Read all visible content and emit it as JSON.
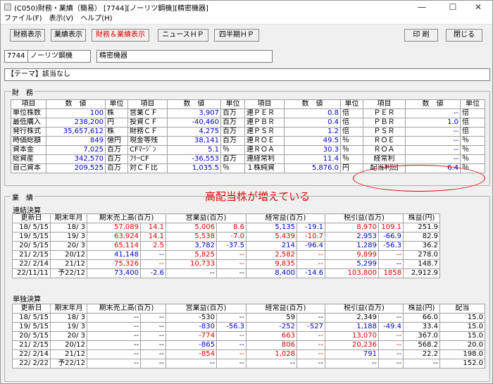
{
  "window": {
    "title": "(C050)財務・業績（簡易） [7744][ノーリツ鋼機][精密機器]",
    "minimize": "—",
    "maximize": "☐",
    "close": "✕"
  },
  "menu": [
    "ファイル(F)",
    "表示(V)",
    "ヘルプ(H)"
  ],
  "toolbar": {
    "fin": "財務表示",
    "perf": "業績表示",
    "both": "財務＆業績表示",
    "news": "ニュースＨＰ",
    "quarter": "四半期ＨＰ",
    "print": "印 刷",
    "closeBtn": "閉じる"
  },
  "company": {
    "code": "7744",
    "name": "ノーリツ鋼機",
    "sector": "精密機器"
  },
  "theme": "【テーマ】該当なし",
  "finance": {
    "label": "財　務",
    "headers": [
      "項目",
      "数　値",
      "単位",
      "項目",
      "数　値",
      "単位",
      "項目",
      "数　値",
      "単位",
      "項目",
      "数　値",
      "単位"
    ],
    "rows": [
      [
        [
          "単位株数",
          ""
        ],
        [
          "100",
          "blue"
        ],
        "株",
        [
          "営業ＣＦ",
          ""
        ],
        [
          "3,907",
          "blue"
        ],
        "百万",
        [
          "連ＰＥＲ",
          ""
        ],
        [
          "0.8",
          "blue"
        ],
        "倍",
        [
          "ＰＥＲ",
          ""
        ],
        [
          "--",
          "blue"
        ],
        "倍"
      ],
      [
        [
          "最低購入",
          ""
        ],
        [
          "238,200",
          "blue"
        ],
        "円",
        [
          "投資ＣＦ",
          ""
        ],
        [
          "-40,460",
          "blue"
        ],
        "百万",
        [
          "連ＰＢＲ",
          ""
        ],
        [
          "0.4",
          "blue"
        ],
        "倍",
        [
          "ＰＢＲ",
          ""
        ],
        [
          "1.0",
          "blue"
        ],
        "倍"
      ],
      [
        [
          "発行株式",
          ""
        ],
        [
          "35,657,612",
          "blue"
        ],
        "株",
        [
          "財務ＣＦ",
          ""
        ],
        [
          "4,275",
          "blue"
        ],
        "百万",
        [
          "連ＰＳＲ",
          ""
        ],
        [
          "1.2",
          "blue"
        ],
        "倍",
        [
          "ＰＳＲ",
          ""
        ],
        [
          "--",
          "blue"
        ],
        "倍"
      ],
      [
        [
          "時価総額",
          ""
        ],
        [
          "849",
          "blue"
        ],
        "億円",
        [
          "現金等残",
          ""
        ],
        [
          "38,141",
          "blue"
        ],
        "百万",
        [
          "連ＲＯＥ",
          ""
        ],
        [
          "49.5",
          "blue"
        ],
        "％",
        [
          "ＲＯＥ",
          ""
        ],
        [
          "--",
          "blue"
        ],
        "％"
      ],
      [
        [
          "資本金",
          ""
        ],
        [
          "7,025",
          "blue"
        ],
        "百万",
        [
          "CFﾏｰｼﾞﾝ",
          ""
        ],
        [
          "5.1",
          "blue"
        ],
        "％",
        [
          "連ＲＯＡ",
          ""
        ],
        [
          "30.3",
          "blue"
        ],
        "％",
        [
          "ＲＯＡ",
          ""
        ],
        [
          "--",
          "blue"
        ],
        "％"
      ],
      [
        [
          "総資産",
          ""
        ],
        [
          "342,570",
          "blue"
        ],
        "百万",
        [
          "ﾌﾘｰCF",
          ""
        ],
        [
          "-36,553",
          "blue"
        ],
        "百万",
        [
          "連経常利",
          ""
        ],
        [
          "11.4",
          "blue"
        ],
        "％",
        [
          "経常利",
          ""
        ],
        [
          "--",
          "blue"
        ],
        "％"
      ],
      [
        [
          "自己資本",
          ""
        ],
        [
          "209,525",
          "blue"
        ],
        "百万",
        [
          "対ＣＦ比",
          ""
        ],
        [
          "1,035.5",
          "blue"
        ],
        "％",
        [
          "１株純資",
          ""
        ],
        [
          "5,876.0",
          "blue"
        ],
        "円",
        [
          "配当利回",
          ""
        ],
        [
          "6.4",
          "blue"
        ],
        "％"
      ]
    ]
  },
  "annotation": "高配当株が増えている",
  "performance": {
    "label": "業　績",
    "consolidated_label": "連結決算",
    "cons_headers": [
      "更新日",
      "期末年月",
      "期末売上高(百万)",
      "営業益(百万)",
      "経常益(百万)",
      "税引益(百万)",
      "株益(円)"
    ],
    "cons_rows": [
      [
        "18/ 5/15",
        "18/ 3",
        [
          "57,089",
          "red"
        ],
        [
          "14.1",
          "red"
        ],
        [
          "5,006",
          "red"
        ],
        [
          "8.6",
          "red"
        ],
        [
          "5,135",
          "blue"
        ],
        [
          "-19.1",
          "blue"
        ],
        [
          "8,970",
          "red"
        ],
        [
          "109.1",
          "red"
        ],
        "251.9"
      ],
      [
        "19/ 5/15",
        "19/ 3",
        [
          "63,924",
          "red"
        ],
        [
          "14.1",
          "red"
        ],
        [
          "5,538",
          "red"
        ],
        [
          "-7.0",
          "red"
        ],
        [
          "5,439",
          "red"
        ],
        [
          "-10.7",
          "red"
        ],
        [
          "2,953",
          "blue"
        ],
        [
          "-66.9",
          "blue"
        ],
        "82.9"
      ],
      [
        "20/ 5/15",
        "20/ 3",
        [
          "65,114",
          "red"
        ],
        [
          "2.5",
          "red"
        ],
        [
          "3,782",
          "blue"
        ],
        [
          "-37.5",
          "blue"
        ],
        [
          "214",
          "blue"
        ],
        [
          "-96.4",
          "blue"
        ],
        [
          "1,289",
          "blue"
        ],
        [
          "-56.3",
          "blue"
        ],
        "36.2"
      ],
      [
        "21/ 2/15",
        "20/12",
        [
          "41,148",
          "blue"
        ],
        [
          "--",
          "blue"
        ],
        [
          "5,825",
          "red"
        ],
        [
          "--",
          "red"
        ],
        [
          "2,582",
          "red"
        ],
        [
          "--",
          "red"
        ],
        [
          "9,899",
          "red"
        ],
        [
          "--",
          "red"
        ],
        "278.0"
      ],
      [
        "22/ 2/14",
        "21/12",
        [
          "75,326",
          "red"
        ],
        [
          "--",
          "red"
        ],
        [
          "10,733",
          "red"
        ],
        [
          "--",
          "red"
        ],
        [
          "9,835",
          "red"
        ],
        [
          "--",
          "red"
        ],
        [
          "5,299",
          "blue"
        ],
        [
          "--",
          "blue"
        ],
        "148.7"
      ],
      [
        "22/11/11",
        "予22/12",
        [
          "73,400",
          "blue"
        ],
        [
          "-2.6",
          "blue"
        ],
        [
          "--",
          ""
        ],
        [
          "--",
          ""
        ],
        [
          "8,400",
          "blue"
        ],
        [
          "-14.6",
          "blue"
        ],
        [
          "103,800",
          "red"
        ],
        [
          "1858",
          "red"
        ],
        "2,912.9"
      ]
    ],
    "single_label": "単独決算",
    "single_headers": [
      "更新日",
      "期末年月",
      "期末売上高(百万)",
      "営業益(百万)",
      "経常益(百万)",
      "税引益(百万)",
      "株益(円)",
      "配当"
    ],
    "single_rows": [
      [
        "18/ 5/15",
        "18/ 3",
        [
          "--",
          ""
        ],
        [
          "--",
          ""
        ],
        [
          "-530",
          ""
        ],
        [
          "--",
          ""
        ],
        [
          "59",
          ""
        ],
        [
          "--",
          ""
        ],
        [
          "2,349",
          ""
        ],
        [
          "--",
          ""
        ],
        "66.0",
        "15.0"
      ],
      [
        "19/ 5/15",
        "19/ 3",
        [
          "--",
          ""
        ],
        [
          "--",
          ""
        ],
        [
          "-830",
          "blue"
        ],
        [
          "-56.3",
          "blue"
        ],
        [
          "-252",
          "blue"
        ],
        [
          "-527",
          "blue"
        ],
        [
          "1,188",
          "blue"
        ],
        [
          "-49.4",
          "blue"
        ],
        "33.4",
        "15.0"
      ],
      [
        "20/ 5/15",
        "20/ 3",
        [
          "--",
          ""
        ],
        [
          "--",
          ""
        ],
        [
          "-774",
          "red"
        ],
        [
          "--",
          "red"
        ],
        [
          "663",
          "red"
        ],
        [
          "--",
          "red"
        ],
        [
          "13,070",
          "red"
        ],
        [
          "--",
          "red"
        ],
        "367.0",
        "15.0"
      ],
      [
        "21/ 2/15",
        "20/12",
        [
          "--",
          ""
        ],
        [
          "--",
          ""
        ],
        [
          "-865",
          "blue"
        ],
        [
          "--",
          "blue"
        ],
        [
          "806",
          "red"
        ],
        [
          "--",
          "red"
        ],
        [
          "20,236",
          "red"
        ],
        [
          "--",
          "red"
        ],
        "568.2",
        "20.0"
      ],
      [
        "22/ 2/14",
        "21/12",
        [
          "--",
          ""
        ],
        [
          "--",
          ""
        ],
        [
          "-854",
          "red"
        ],
        [
          "--",
          "red"
        ],
        [
          "1,028",
          "red"
        ],
        [
          "--",
          "red"
        ],
        [
          "791",
          "blue"
        ],
        [
          "--",
          "blue"
        ],
        "22.2",
        "198.0"
      ],
      [
        "22/ 2/22",
        "予22/12",
        [
          "--",
          ""
        ],
        [
          "--",
          ""
        ],
        [
          "--",
          ""
        ],
        [
          "--",
          ""
        ],
        [
          "--",
          ""
        ],
        [
          "--",
          ""
        ],
        [
          "--",
          ""
        ],
        [
          "--",
          ""
        ],
        "--",
        "152.0"
      ]
    ]
  }
}
